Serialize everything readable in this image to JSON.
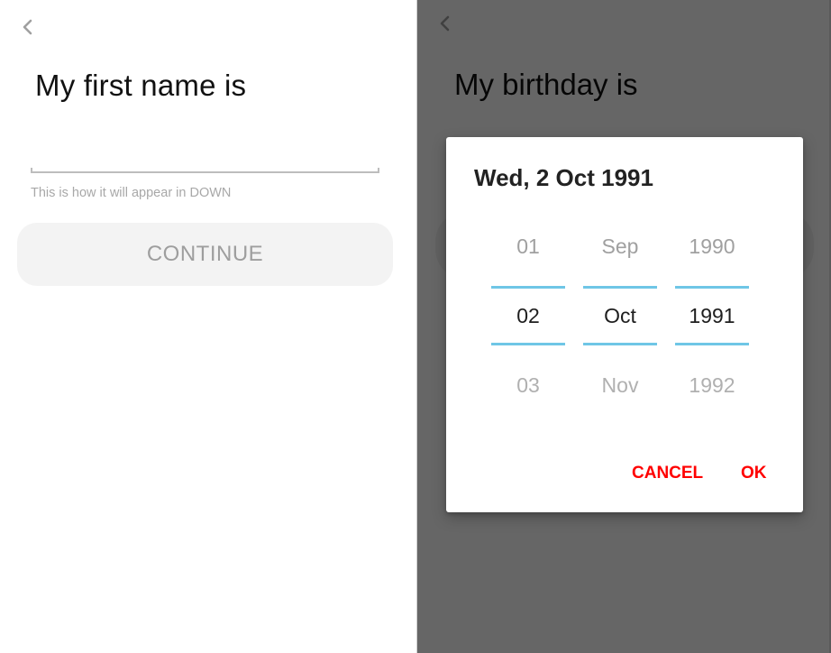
{
  "left_screen": {
    "back_icon": "chevron-left-icon",
    "title": "My first name is",
    "name_input": {
      "value": "",
      "placeholder": ""
    },
    "helper_text": "This is how it will appear in DOWN",
    "continue_label": "CONTINUE"
  },
  "right_screen": {
    "back_icon": "chevron-left-icon",
    "title": "My birthday is",
    "date_dialog": {
      "header_date": "Wed, 2 Oct 1991",
      "day_column": {
        "prev": "01",
        "selected": "02",
        "next": "03"
      },
      "month_column": {
        "prev": "Sep",
        "selected": "Oct",
        "next": "Nov"
      },
      "year_column": {
        "prev": "1990",
        "selected": "1991",
        "next": "1992"
      },
      "cancel_label": "CANCEL",
      "ok_label": "OK"
    }
  },
  "colors": {
    "accent_button_text": "#ff0000",
    "selection_line": "#6fc6e6",
    "overlay": "#666666",
    "disabled_button_bg": "#f3f3f3",
    "disabled_button_text": "#9e9e9e"
  }
}
